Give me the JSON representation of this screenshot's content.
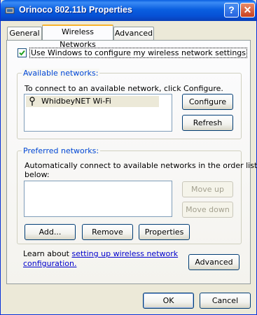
{
  "window": {
    "title": "Orinoco 802.11b Properties",
    "help_label": "?",
    "close_label": "✕"
  },
  "tabs": [
    {
      "label": "General",
      "active": false
    },
    {
      "label": "Wireless Networks",
      "active": true
    },
    {
      "label": "Advanced",
      "active": false
    }
  ],
  "use_windows_checkbox": {
    "label": "Use Windows to configure my wireless network settings",
    "checked": true
  },
  "available": {
    "title": "Available networks:",
    "description": "To connect to an available network, click Configure.",
    "networks": [
      "WhidbeyNET Wi-Fi"
    ],
    "configure_label": "Configure",
    "refresh_label": "Refresh"
  },
  "preferred": {
    "title": "Preferred networks:",
    "description_line1": "Automatically connect to available networks in the order listed",
    "description_line2": "below:",
    "move_up_label": "Move up",
    "move_down_label": "Move down",
    "add_label": "Add...",
    "remove_label": "Remove",
    "properties_label": "Properties"
  },
  "learn": {
    "prefix": "Learn about ",
    "link_line1": "setting up wireless network",
    "link_line2": "configuration.",
    "advanced_label": "Advanced"
  },
  "footer": {
    "ok_label": "OK",
    "cancel_label": "Cancel"
  }
}
